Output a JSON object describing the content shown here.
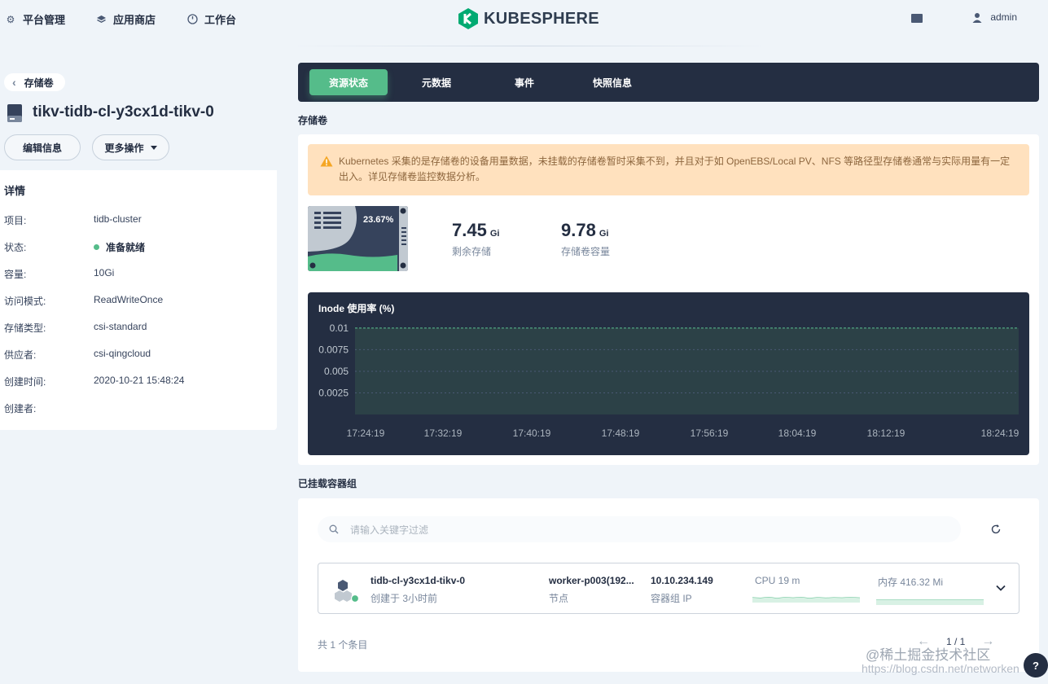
{
  "topnav": {
    "items": [
      {
        "label": "平台管理",
        "icon": "gear-icon"
      },
      {
        "label": "应用商店",
        "icon": "stack-icon"
      },
      {
        "label": "工作台",
        "icon": "dashboard-icon"
      }
    ],
    "logo_text": "KUBESPHERE",
    "user": "admin"
  },
  "left": {
    "back_label": "存储卷",
    "title": "tikv-tidb-cl-y3cx1d-tikv-0",
    "edit_label": "编辑信息",
    "more_label": "更多操作",
    "details_title": "详情",
    "details": [
      {
        "key": "项目:",
        "value": "tidb-cluster"
      },
      {
        "key": "状态:",
        "value": "准备就绪"
      },
      {
        "key": "容量:",
        "value": "10Gi"
      },
      {
        "key": "访问模式:",
        "value": "ReadWriteOnce"
      },
      {
        "key": "存储类型:",
        "value": "csi-standard"
      },
      {
        "key": "供应者:",
        "value": "csi-qingcloud"
      },
      {
        "key": "创建时间:",
        "value": "2020-10-21 15:48:24"
      },
      {
        "key": "创建者:",
        "value": ""
      }
    ]
  },
  "tabs": [
    "资源状态",
    "元数据",
    "事件",
    "快照信息"
  ],
  "volume_section": {
    "label": "存储卷",
    "warning": "Kubernetes 采集的是存储卷的设备用量数据，未挂载的存储卷暂时采集不到，并且对于如 OpenEBS/Local PV、NFS 等路径型存储卷通常与实际用量有一定出入。详见存储卷监控数据分析。",
    "usage_percent": "23.67%",
    "usage_fraction": 0.2367,
    "remaining": {
      "value": "7.45",
      "unit": "Gi",
      "label": "剩余存储"
    },
    "capacity": {
      "value": "9.78",
      "unit": "Gi",
      "label": "存储卷容量"
    }
  },
  "chart_data": {
    "type": "area",
    "title": "Inode 使用率 (%)",
    "xlabel": "",
    "ylabel": "",
    "y_ticks": [
      "0.01",
      "0.0075",
      "0.005",
      "0.0025"
    ],
    "x": [
      "17:24:19",
      "17:32:19",
      "17:40:19",
      "17:48:19",
      "17:56:19",
      "18:04:19",
      "18:12:19",
      "18:24:19"
    ],
    "series": [
      {
        "values": [
          0.01,
          0.01,
          0.01,
          0.01,
          0.01,
          0.01,
          0.01,
          0.01
        ]
      }
    ],
    "ylim": [
      0,
      0.0115
    ],
    "grid": true,
    "colors": {
      "line": "#55bc8a",
      "fill": "#2d4448"
    }
  },
  "pods_section": {
    "label": "已挂载容器组",
    "search_placeholder": "请输入关键字过滤",
    "pod": {
      "name": "tidb-cl-y3cx1d-tikv-0",
      "created": "创建于 3小时前",
      "node": "worker-p003(192...",
      "node_label": "节点",
      "ip": "10.10.234.149",
      "ip_label": "容器组 IP",
      "cpu": "CPU 19 m",
      "memory": "内存 416.32 Mi"
    },
    "total": "共 1 个条目",
    "page": "1 / 1"
  },
  "watermark": "@稀土掘金技术社区",
  "watermark_url": "https://blog.csdn.net/networken",
  "colors": {
    "accent": "#55bc8a",
    "dark": "#242e42",
    "warning_bg": "#ffe1be"
  }
}
